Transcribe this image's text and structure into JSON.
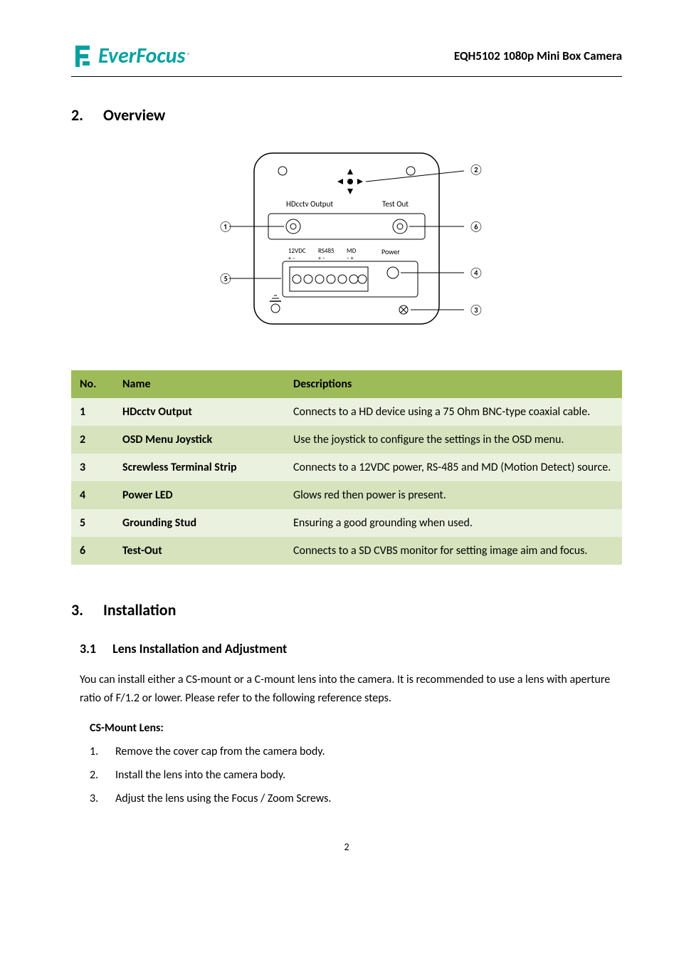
{
  "header": {
    "logo_text": "EverFocus",
    "logo_sup": "®",
    "doc_title": "EQH5102 1080p Mini Box Camera"
  },
  "section2": {
    "num": "2.",
    "title": "Overview"
  },
  "diagram": {
    "labels": {
      "hdcctv_output": "HDcctv Output",
      "test_out": "Test Out",
      "twelve_vdc": "12VDC",
      "rs485": "RS485",
      "md": "MD",
      "power": "Power"
    },
    "callouts": [
      "①",
      "②",
      "③",
      "④",
      "⑤",
      "⑥"
    ]
  },
  "table": {
    "headers": {
      "no": "No.",
      "name": "Name",
      "desc": "Descriptions"
    },
    "rows": [
      {
        "no": "1",
        "name": "HDcctv Output",
        "desc": "Connects to a HD device using a 75 Ohm BNC-type coaxial cable."
      },
      {
        "no": "2",
        "name": "OSD Menu Joystick",
        "desc": "Use the joystick to configure the settings in the OSD menu."
      },
      {
        "no": "3",
        "name": "Screwless Terminal Strip",
        "desc": "Connects to a 12VDC power, RS-485 and MD (Motion Detect) source."
      },
      {
        "no": "4",
        "name": "Power LED",
        "desc": "Glows red then power is present."
      },
      {
        "no": "5",
        "name": "Grounding Stud",
        "desc": "Ensuring a good grounding when used."
      },
      {
        "no": "6",
        "name": "Test-Out",
        "desc": "Connects to a SD CVBS monitor for setting image aim and focus."
      }
    ]
  },
  "section3": {
    "num": "3.",
    "title": "Installation",
    "sub": {
      "num": "3.1",
      "title": "Lens Installation and Adjustment",
      "body": "You can install either a CS-mount or a C-mount lens into the camera. It is recommended to use a lens with aperture ratio of F/1.2 or lower. Please refer to the following reference steps.",
      "cs_label": "CS-Mount Lens:",
      "steps": [
        {
          "n": "1.",
          "t": "Remove the cover cap from the camera body."
        },
        {
          "n": "2.",
          "t": "Install the lens into the camera body."
        },
        {
          "n": "3.",
          "t": "Adjust the lens using the Focus / Zoom Screws."
        }
      ]
    }
  },
  "page_number": "2"
}
